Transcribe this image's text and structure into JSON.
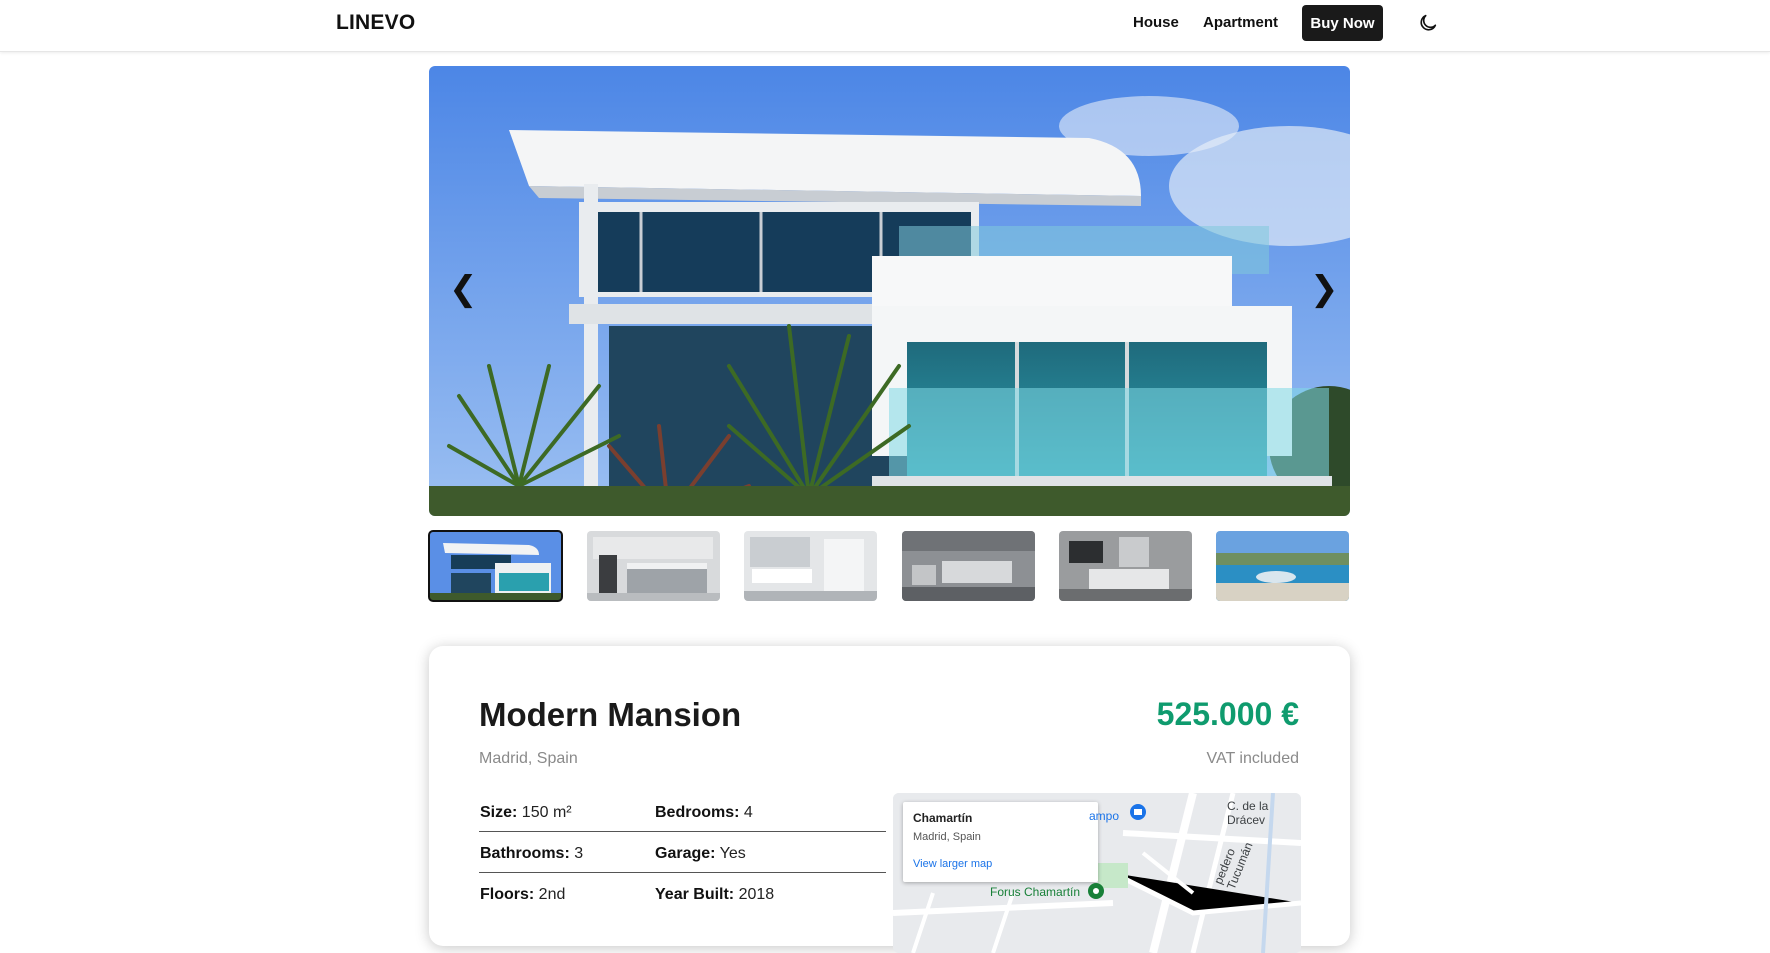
{
  "header": {
    "logo": "LINEVO",
    "nav": [
      "House",
      "Apartment"
    ],
    "cta": "Buy Now",
    "theme_icon": "moon-icon"
  },
  "gallery": {
    "prev_icon": "❮",
    "next_icon": "❯",
    "thumbnails": [
      "modern-house",
      "kitchen",
      "bathroom",
      "bedroom",
      "bedroom-2",
      "pool"
    ],
    "active_index": 0
  },
  "listing": {
    "title": "Modern Mansion",
    "location": "Madrid, Spain",
    "price": "525.000 €",
    "vat": "VAT included",
    "specs": [
      {
        "label": "Size:",
        "value": "150 m²"
      },
      {
        "label": "Bedrooms:",
        "value": "4"
      },
      {
        "label": "Bathrooms:",
        "value": "3"
      },
      {
        "label": "Garage:",
        "value": "Yes"
      },
      {
        "label": "Floors:",
        "value": "2nd"
      },
      {
        "label": "Year Built:",
        "value": "2018"
      }
    ]
  },
  "map": {
    "place": "Chamartín",
    "region": "Madrid, Spain",
    "link": "View larger map",
    "poi": "Forus Chamartín",
    "street_1": "C. de la Drácev",
    "street_2": "pedero Tucumán",
    "poi_partial": "ampo"
  },
  "colors": {
    "price": "#0f9b6e",
    "cta_bg": "#1a1a1a",
    "map_link": "#1a73e8"
  }
}
